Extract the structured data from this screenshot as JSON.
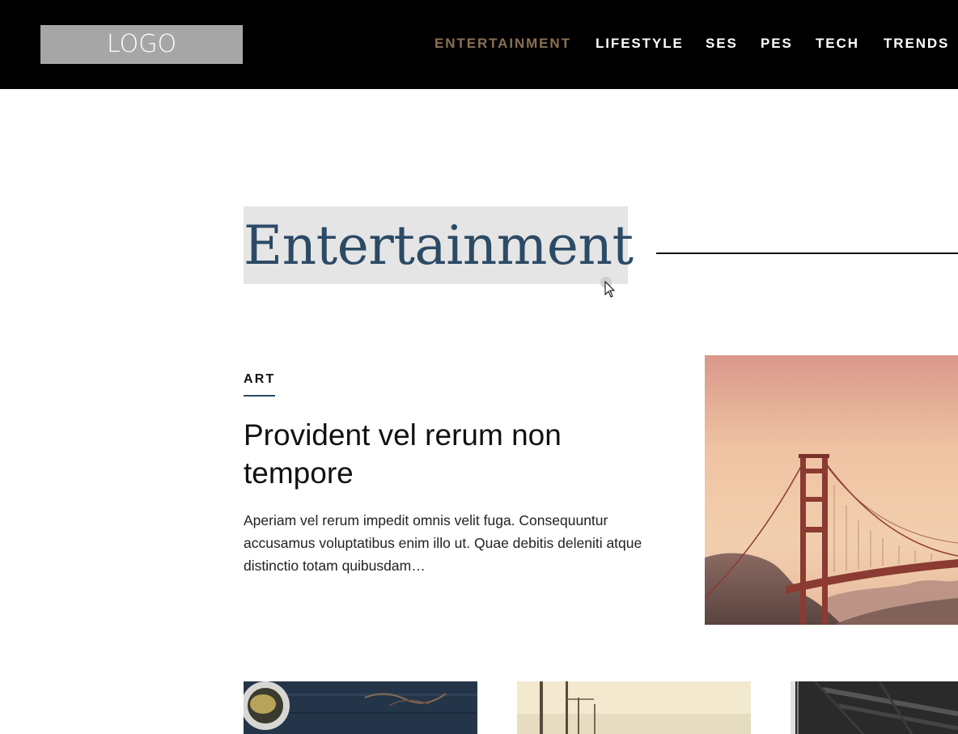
{
  "header": {
    "logo_text": "LOGO",
    "nav": [
      {
        "label": "ENTERTAINMENT",
        "active": true
      },
      {
        "label": "LIFESTYLE",
        "active": false
      },
      {
        "label": "SES",
        "active": false
      },
      {
        "label": "PES",
        "active": false
      },
      {
        "label": "TECH",
        "active": false
      },
      {
        "label": "TRENDS",
        "active": false
      }
    ]
  },
  "page": {
    "title": "Entertainment"
  },
  "featured": {
    "category": "ART",
    "title": "Provident vel rerum non tempore",
    "excerpt": "Aperiam vel rerum impedit omnis velit fuga. Consequuntur accusamus voluptatibus enim illo ut. Quae debitis deleniti atque distinctio totam quibusdam…"
  },
  "colors": {
    "header_bg": "#000000",
    "nav_active": "#8a7153",
    "nav_default": "#ffffff",
    "title_color": "#2b4a66",
    "title_highlight": "#e5e5e5",
    "logo_bg": "#a6a6a6"
  },
  "icons": {
    "cursor": "mouse-pointer-icon"
  }
}
